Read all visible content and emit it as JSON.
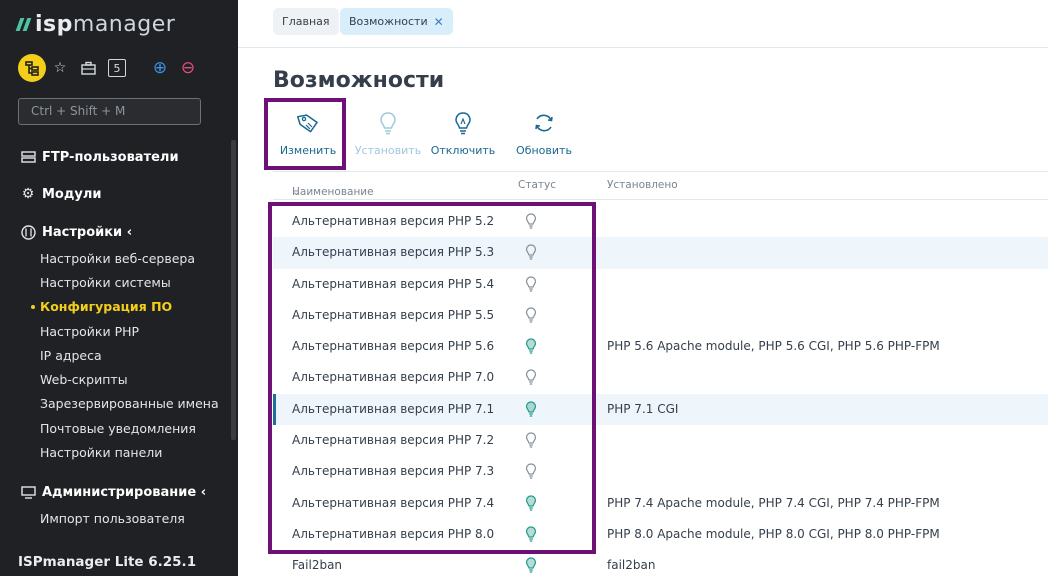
{
  "sidebar": {
    "logo": {
      "bold": "isp",
      "light": "manager"
    },
    "quick_icons": [
      "layers-icon",
      "star-icon",
      "briefcase-icon",
      "counter-icon",
      "plus-circle-icon",
      "minus-circle-icon"
    ],
    "counter": "5",
    "search_placeholder": "Ctrl + Shift + M",
    "nav": {
      "ftp": "FTP-пользователи",
      "modules": "Модули",
      "settings": "Настройки ‹",
      "settings_items": [
        "Настройки веб-сервера",
        "Настройки системы",
        "Конфигурация ПО",
        "Настройки PHP",
        "IP адреса",
        "Web-скрипты",
        "Зарезервированные имена",
        "Почтовые уведомления",
        "Настройки панели"
      ],
      "admin": "Администрирование ‹",
      "admin_items": [
        "Импорт пользователя"
      ]
    },
    "version": "ISPmanager Lite 6.25.1"
  },
  "tabs": {
    "home": "Главная",
    "current": "Возможности"
  },
  "page_title": "Возможности",
  "toolbar": {
    "edit": "Изменить",
    "install": "Установить",
    "disable": "Отключить",
    "refresh": "Обновить"
  },
  "table": {
    "headers": {
      "name": "Наименование",
      "status": "Статус",
      "installed": "Установлено"
    },
    "rows": [
      {
        "name": "Альтернативная версия PHP 5.2",
        "installed": "",
        "on": false
      },
      {
        "name": "Альтернативная версия PHP 5.3",
        "installed": "",
        "on": false
      },
      {
        "name": "Альтернативная версия PHP 5.4",
        "installed": "",
        "on": false
      },
      {
        "name": "Альтернативная версия PHP 5.5",
        "installed": "",
        "on": false
      },
      {
        "name": "Альтернативная версия PHP 5.6",
        "installed": "PHP 5.6 Apache module, PHP 5.6 CGI, PHP 5.6 PHP-FPM",
        "on": true
      },
      {
        "name": "Альтернативная версия PHP 7.0",
        "installed": "",
        "on": false
      },
      {
        "name": "Альтернативная версия PHP 7.1",
        "installed": "PHP 7.1 CGI",
        "on": true
      },
      {
        "name": "Альтернативная версия PHP 7.2",
        "installed": "",
        "on": false
      },
      {
        "name": "Альтернативная версия PHP 7.3",
        "installed": "",
        "on": false
      },
      {
        "name": "Альтернативная версия PHP 7.4",
        "installed": "PHP 7.4 Apache module, PHP 7.4 CGI, PHP 7.4 PHP-FPM",
        "on": true
      },
      {
        "name": "Альтернативная версия PHP 8.0",
        "installed": "PHP 8.0 Apache module, PHP 8.0 CGI, PHP 8.0 PHP-FPM",
        "on": true
      },
      {
        "name": "Fail2ban",
        "installed": "fail2ban",
        "on": true
      }
    ]
  },
  "colors": {
    "accent": "#18698f",
    "highlight": "#6d1176",
    "active_nav": "#f4cf1a",
    "bulb_on": "#2a9d8f",
    "bulb_off": "#8a949c"
  }
}
